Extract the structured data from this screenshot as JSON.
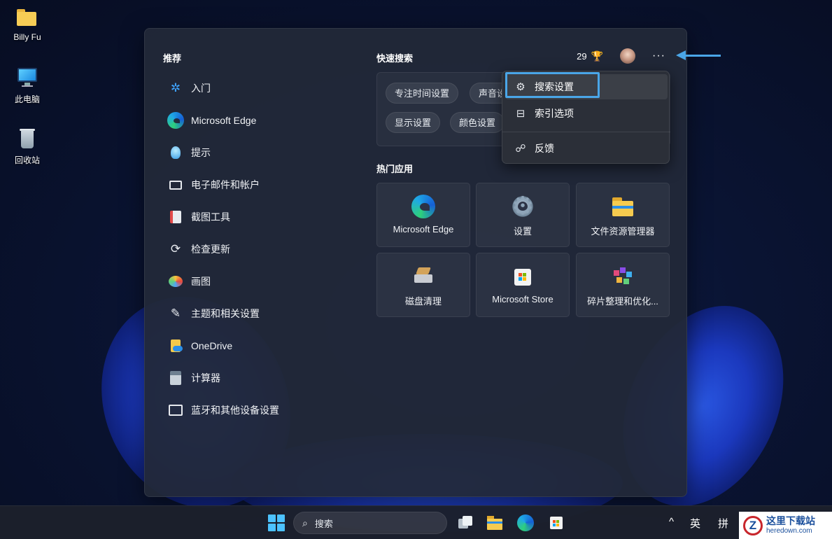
{
  "desktop": {
    "icons": [
      {
        "label": "Billy Fu",
        "icon": "folder-icon"
      },
      {
        "label": "此电脑",
        "icon": "computer-icon"
      },
      {
        "label": "回收站",
        "icon": "recycle-bin-icon"
      }
    ]
  },
  "search_panel": {
    "recommended": {
      "title": "推荐",
      "items": [
        {
          "label": "入门",
          "icon": "get-started-icon"
        },
        {
          "label": "Microsoft Edge",
          "icon": "edge-icon"
        },
        {
          "label": "提示",
          "icon": "tips-icon"
        },
        {
          "label": "电子邮件和帐户",
          "icon": "mail-icon"
        },
        {
          "label": "截图工具",
          "icon": "snipping-tool-icon"
        },
        {
          "label": "检查更新",
          "icon": "update-icon"
        },
        {
          "label": "画图",
          "icon": "paint-icon"
        },
        {
          "label": "主题和相关设置",
          "icon": "brush-icon"
        },
        {
          "label": "OneDrive",
          "icon": "onedrive-icon"
        },
        {
          "label": "计算器",
          "icon": "calculator-icon"
        },
        {
          "label": "蓝牙和其他设备设置",
          "icon": "bluetooth-devices-icon"
        }
      ]
    },
    "quick_search": {
      "title": "快速搜索",
      "chips": [
        "专注时间设置",
        "声音设置",
        "显示设置",
        "颜色设置"
      ]
    },
    "header": {
      "points": "29",
      "points_icon": "trophy-icon",
      "more_label": "···"
    },
    "top_apps": {
      "title": "热门应用",
      "tiles": [
        {
          "label": "Microsoft Edge",
          "icon": "edge-icon"
        },
        {
          "label": "设置",
          "icon": "settings-gear-icon"
        },
        {
          "label": "文件资源管理器",
          "icon": "file-explorer-icon"
        },
        {
          "label": "磁盘清理",
          "icon": "disk-cleanup-icon"
        },
        {
          "label": "Microsoft Store",
          "icon": "store-icon"
        },
        {
          "label": "碎片整理和优化...",
          "icon": "defrag-icon"
        }
      ]
    },
    "menu": {
      "items": [
        {
          "label": "搜索设置",
          "icon": "gear-icon",
          "focused": true
        },
        {
          "label": "索引选项",
          "icon": "index-options-icon"
        },
        {
          "label": "反馈",
          "icon": "feedback-icon"
        }
      ]
    }
  },
  "taskbar": {
    "search_placeholder": "搜索",
    "tray": {
      "language": "英",
      "ime": "拼",
      "overflow": "^"
    }
  },
  "watermark": {
    "logo": "Z",
    "name": "这里下载站",
    "url": "heredown.com"
  },
  "colors": {
    "accent": "#4aa6e8",
    "panel_bg": "#222838",
    "menu_bg": "#2b2f38"
  }
}
